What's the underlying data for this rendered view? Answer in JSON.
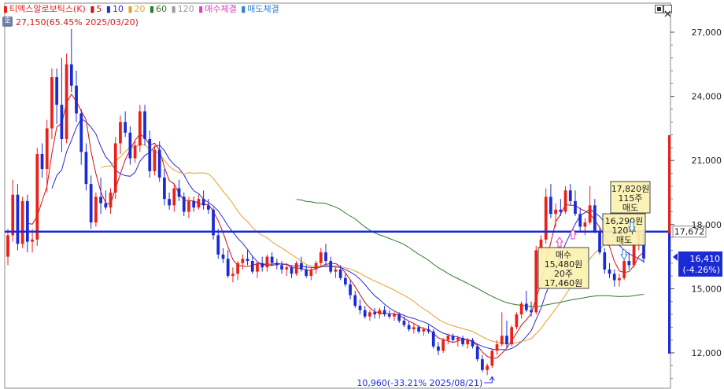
{
  "legend": {
    "title": "티엑스알로보틱스(K)",
    "ma5": "5",
    "ma10": "10",
    "ma20": "20",
    "ma60": "60",
    "ma120": "120",
    "buy_label": "매수체결",
    "sell_label": "매도체결",
    "high_note": "27,150(65.45% 2025/03/20)",
    "tab_label": "호"
  },
  "colors": {
    "up": "#e8211b",
    "down": "#1a2bd6",
    "ma5": "#d01010",
    "ma10": "#2b2bd0",
    "ma20": "#e6a126",
    "ma60": "#2f7a2f",
    "ma120": "#9a9a9a",
    "current_line": "#1a2bd6"
  },
  "chart_data": {
    "type": "candlestick",
    "yticks": [
      12000,
      15000,
      18000,
      21000,
      24000,
      27000
    ],
    "ytick_labels": [
      "12,000",
      "15,000",
      "18,000",
      "21,000",
      "24,000",
      "27,000"
    ],
    "ylim": [
      10700,
      28300
    ],
    "current_price": 17672,
    "current_price_label": "17,672",
    "last_price_label": "16,410",
    "last_change_label": "(-4.26%)",
    "high_annotation": "27,150(65.45% 2025/03/20)",
    "low_annotation": "10,960(-33.21% 2025/08/21)",
    "low_value": 10960,
    "sell_note_1": [
      "17,820원",
      "115주",
      "매도"
    ],
    "sell_note_2": [
      "16,290원",
      "120주",
      "매도"
    ],
    "buy_note": [
      "매수",
      "15,480원",
      "20주",
      "17,460원"
    ],
    "ma60_visible": true,
    "candles": [
      [
        16500,
        17800,
        16100,
        17500
      ],
      [
        17500,
        20100,
        17200,
        19400
      ],
      [
        19400,
        19900,
        16800,
        17100
      ],
      [
        17100,
        19300,
        16900,
        19100
      ],
      [
        19100,
        19400,
        16700,
        17200
      ],
      [
        17200,
        17800,
        16700,
        17300
      ],
      [
        17300,
        21600,
        17000,
        21300
      ],
      [
        21300,
        21800,
        20200,
        20600
      ],
      [
        20600,
        22900,
        19500,
        22500
      ],
      [
        22500,
        25300,
        22000,
        24900
      ],
      [
        24900,
        25300,
        22700,
        23600
      ],
      [
        23600,
        25800,
        21400,
        22000
      ],
      [
        22000,
        26000,
        21800,
        25500
      ],
      [
        25500,
        27150,
        24200,
        24500
      ],
      [
        24500,
        25200,
        22800,
        23200
      ],
      [
        23200,
        23400,
        20800,
        21400
      ],
      [
        21400,
        21800,
        19600,
        19900
      ],
      [
        19900,
        20300,
        17800,
        18100
      ],
      [
        18100,
        19500,
        17900,
        19300
      ],
      [
        19300,
        20200,
        18500,
        19000
      ],
      [
        19000,
        19600,
        18700,
        18800
      ],
      [
        18800,
        19700,
        18500,
        19500
      ],
      [
        19500,
        22100,
        19200,
        21800
      ],
      [
        21800,
        23100,
        21300,
        22800
      ],
      [
        22800,
        23300,
        22100,
        22300
      ],
      [
        22300,
        22600,
        20800,
        21100
      ],
      [
        21100,
        21900,
        20900,
        21700
      ],
      [
        21700,
        23600,
        21400,
        23300
      ],
      [
        23300,
        23600,
        21700,
        22000
      ],
      [
        22000,
        22400,
        20200,
        20500
      ],
      [
        20500,
        21700,
        20300,
        21500
      ],
      [
        21500,
        21900,
        20000,
        20200
      ],
      [
        20200,
        20600,
        18900,
        19200
      ],
      [
        19200,
        19500,
        18700,
        18900
      ],
      [
        18900,
        19900,
        18600,
        19700
      ],
      [
        19700,
        20100,
        19100,
        19300
      ],
      [
        19300,
        19500,
        18400,
        18600
      ],
      [
        18600,
        19300,
        18300,
        19100
      ],
      [
        19100,
        19300,
        18600,
        18800
      ],
      [
        18800,
        19400,
        18700,
        19200
      ],
      [
        19200,
        19600,
        18700,
        18900
      ],
      [
        18900,
        19200,
        18500,
        18700
      ],
      [
        18700,
        18800,
        17300,
        17500
      ],
      [
        17500,
        17800,
        16400,
        16600
      ],
      [
        16600,
        16900,
        16200,
        16400
      ],
      [
        16400,
        16800,
        15500,
        15600
      ],
      [
        15600,
        16000,
        15300,
        15700
      ],
      [
        15700,
        16300,
        15400,
        16200
      ],
      [
        16200,
        16600,
        15900,
        16400
      ],
      [
        16400,
        16800,
        16100,
        16300
      ],
      [
        16300,
        16500,
        15700,
        15800
      ],
      [
        15800,
        16300,
        15500,
        16200
      ],
      [
        16200,
        16500,
        15800,
        16000
      ],
      [
        16000,
        16600,
        15800,
        16500
      ],
      [
        16500,
        16700,
        16100,
        16200
      ],
      [
        16200,
        16400,
        15900,
        16100
      ],
      [
        16100,
        16300,
        15700,
        15900
      ],
      [
        15900,
        16200,
        15600,
        16000
      ],
      [
        16000,
        16100,
        15500,
        15700
      ],
      [
        15700,
        16300,
        15600,
        16200
      ],
      [
        16200,
        16500,
        15800,
        15900
      ],
      [
        15900,
        16100,
        15500,
        15600
      ],
      [
        15600,
        16000,
        15400,
        15900
      ],
      [
        15900,
        16300,
        15700,
        16200
      ],
      [
        16200,
        16900,
        16000,
        16700
      ],
      [
        16700,
        17100,
        16100,
        16300
      ],
      [
        16300,
        16500,
        15700,
        15800
      ],
      [
        15800,
        16000,
        15500,
        15900
      ],
      [
        15900,
        16100,
        15400,
        15500
      ],
      [
        15500,
        15700,
        15100,
        15200
      ],
      [
        15200,
        15400,
        14500,
        14700
      ],
      [
        14700,
        14900,
        14100,
        14200
      ],
      [
        14200,
        14500,
        13800,
        14000
      ],
      [
        14000,
        14200,
        13600,
        13700
      ],
      [
        13700,
        14000,
        13500,
        13900
      ],
      [
        13900,
        14100,
        13600,
        13800
      ],
      [
        13800,
        14100,
        13600,
        14000
      ],
      [
        14000,
        14200,
        13700,
        13800
      ],
      [
        13800,
        14000,
        13600,
        13700
      ],
      [
        13700,
        13900,
        13500,
        13800
      ],
      [
        13800,
        13900,
        13400,
        13500
      ],
      [
        13500,
        13700,
        13200,
        13300
      ],
      [
        13300,
        13500,
        13000,
        13100
      ],
      [
        13100,
        13400,
        12900,
        13200
      ],
      [
        13200,
        13300,
        12900,
        13000
      ],
      [
        13000,
        13200,
        12800,
        13100
      ],
      [
        13100,
        13300,
        12900,
        13000
      ],
      [
        13000,
        13100,
        12200,
        12300
      ],
      [
        12300,
        12500,
        11900,
        12100
      ],
      [
        12100,
        12700,
        12000,
        12600
      ],
      [
        12600,
        12900,
        12400,
        12800
      ],
      [
        12800,
        12900,
        12500,
        12600
      ],
      [
        12600,
        12800,
        12300,
        12700
      ],
      [
        12700,
        12800,
        12300,
        12400
      ],
      [
        12400,
        12700,
        12200,
        12600
      ],
      [
        12600,
        12700,
        12200,
        12300
      ],
      [
        12300,
        12400,
        11600,
        11700
      ],
      [
        11700,
        11900,
        11100,
        11200
      ],
      [
        11200,
        11500,
        10960,
        11400
      ],
      [
        11400,
        12200,
        11300,
        12100
      ],
      [
        12100,
        12600,
        11900,
        12400
      ],
      [
        12400,
        13900,
        12300,
        12800
      ],
      [
        12800,
        13500,
        12200,
        12400
      ],
      [
        12400,
        13300,
        12300,
        13200
      ],
      [
        13200,
        13900,
        13100,
        13800
      ],
      [
        13800,
        14400,
        13600,
        14300
      ],
      [
        14300,
        14900,
        13900,
        14000
      ],
      [
        14000,
        14400,
        13700,
        13900
      ],
      [
        13900,
        17000,
        13800,
        16800
      ],
      [
        16800,
        17500,
        16600,
        17300
      ],
      [
        17300,
        19700,
        17100,
        19300
      ],
      [
        19300,
        19900,
        18300,
        18500
      ],
      [
        18500,
        19000,
        17900,
        18700
      ],
      [
        18700,
        19200,
        18400,
        18600
      ],
      [
        18600,
        19800,
        18500,
        19600
      ],
      [
        19600,
        19900,
        18900,
        19100
      ],
      [
        19100,
        19600,
        18400,
        18500
      ],
      [
        18500,
        18800,
        17700,
        17900
      ],
      [
        17900,
        18300,
        17500,
        18100
      ],
      [
        18100,
        19800,
        18000,
        18900
      ],
      [
        18900,
        19200,
        17600,
        17700
      ],
      [
        17700,
        17900,
        16600,
        16700
      ],
      [
        16700,
        16900,
        15700,
        15900
      ],
      [
        15900,
        16200,
        15500,
        15700
      ],
      [
        15700,
        15900,
        15100,
        15400
      ],
      [
        15400,
        15700,
        15100,
        15500
      ],
      [
        15500,
        16400,
        15400,
        16300
      ],
      [
        16300,
        16700,
        15900,
        16100
      ],
      [
        16100,
        17200,
        16000,
        17100
      ],
      [
        17100,
        18300,
        16800,
        17600
      ],
      [
        17600,
        17800,
        16200,
        16410
      ]
    ]
  }
}
